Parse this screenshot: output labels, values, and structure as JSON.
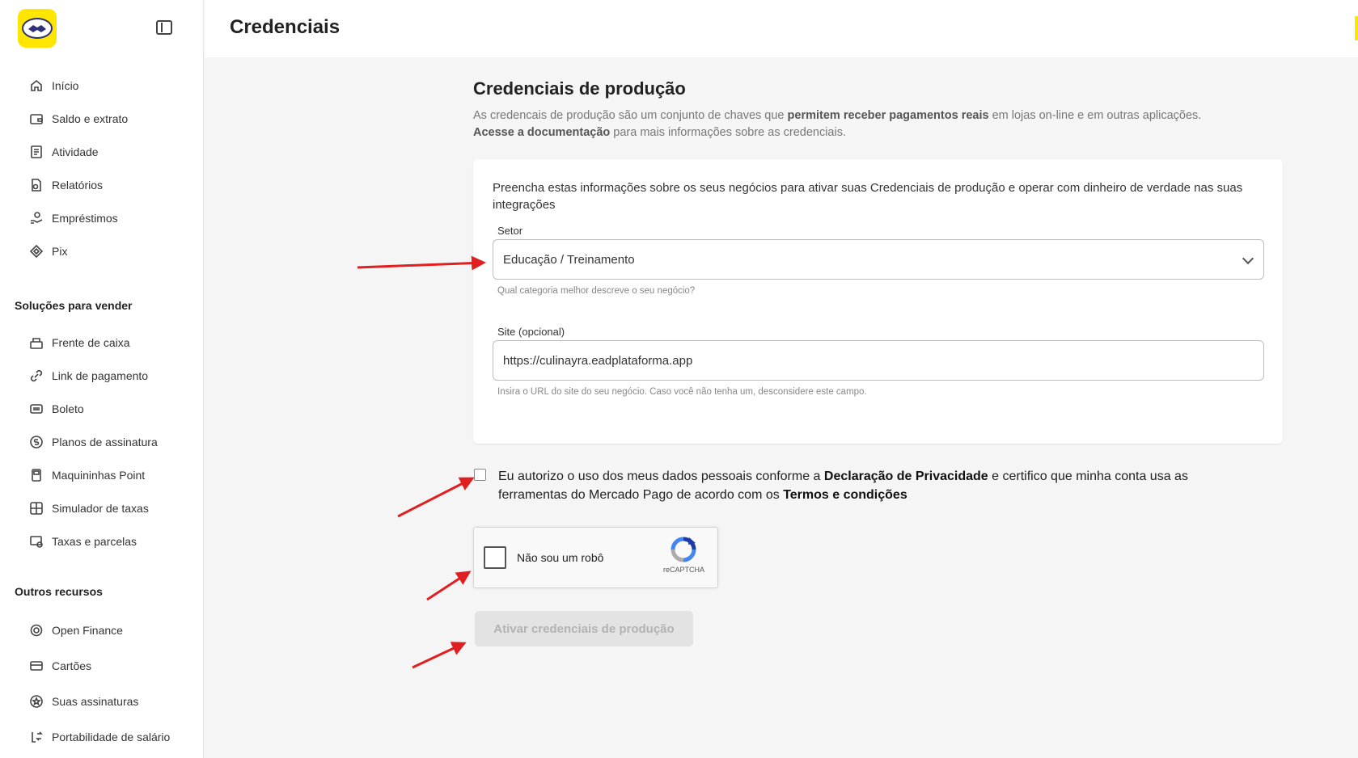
{
  "sidebar": {
    "logo_icon": "handshake-icon",
    "collapse_icon": "sidebar-toggle-icon",
    "main_items": [
      {
        "label": "Início",
        "icon": "home-icon"
      },
      {
        "label": "Saldo e extrato",
        "icon": "wallet-icon"
      },
      {
        "label": "Atividade",
        "icon": "receipt-icon"
      },
      {
        "label": "Relatórios",
        "icon": "report-icon"
      },
      {
        "label": "Empréstimos",
        "icon": "loan-icon"
      },
      {
        "label": "Pix",
        "icon": "pix-icon"
      }
    ],
    "sell_section_title": "Soluções para vender",
    "sell_items": [
      {
        "label": "Frente de caixa",
        "icon": "register-icon"
      },
      {
        "label": "Link de pagamento",
        "icon": "link-icon"
      },
      {
        "label": "Boleto",
        "icon": "barcode-icon"
      },
      {
        "label": "Planos de assinatura",
        "icon": "subscription-icon"
      },
      {
        "label": "Maquininhas Point",
        "icon": "pos-icon"
      },
      {
        "label": "Simulador de taxas",
        "icon": "calculator-icon"
      },
      {
        "label": "Taxas e parcelas",
        "icon": "fees-icon"
      }
    ],
    "other_section_title": "Outros recursos",
    "other_items": [
      {
        "label": "Open Finance",
        "icon": "open-finance-icon"
      },
      {
        "label": "Cartões",
        "icon": "card-icon"
      },
      {
        "label": "Suas assinaturas",
        "icon": "star-badge-icon"
      },
      {
        "label": "Portabilidade de salário",
        "icon": "transfer-icon"
      }
    ]
  },
  "header": {
    "title": "Credenciais"
  },
  "main": {
    "title": "Credenciais de produção",
    "desc_part1": "As credencais de produção são um conjunto de chaves que ",
    "desc_bold1": "permitem receber pagamentos reais",
    "desc_part2": " em lojas on-line e em outras aplicações.",
    "desc_bold2": "Acesse a documentação",
    "desc_part3": " para mais informações sobre as credenciais.",
    "card": {
      "intro": "Preencha estas informações sobre os seus negócios para ativar suas Credenciais de produção e operar com dinheiro de verdade nas suas integrações",
      "sector_label": "Setor",
      "sector_value": "Educação / Treinamento",
      "sector_helper": "Qual categoria melhor descreve o seu negócio?",
      "site_label": "Site (opcional)",
      "site_value": "https://culinayra.eadplataforma.app",
      "site_helper": "Insira o URL do site do seu negócio. Caso você não tenha um, desconsidere este campo."
    },
    "consent_part1": "Eu autorizo o uso dos meus dados pessoais conforme a ",
    "consent_bold1": "Declaração de Privacidade",
    "consent_part2": " e certifico que minha conta usa as ferramentas do Mercado Pago de acordo com os ",
    "consent_bold2": "Termos e condições",
    "recaptcha_label": "Não sou um robô",
    "recaptcha_brand": "reCAPTCHA",
    "activate_button": "Ativar credenciais de produção"
  },
  "colors": {
    "accent_yellow": "#ffe600",
    "annotation_red": "#e02020",
    "disabled_bg": "#e3e3e3"
  }
}
